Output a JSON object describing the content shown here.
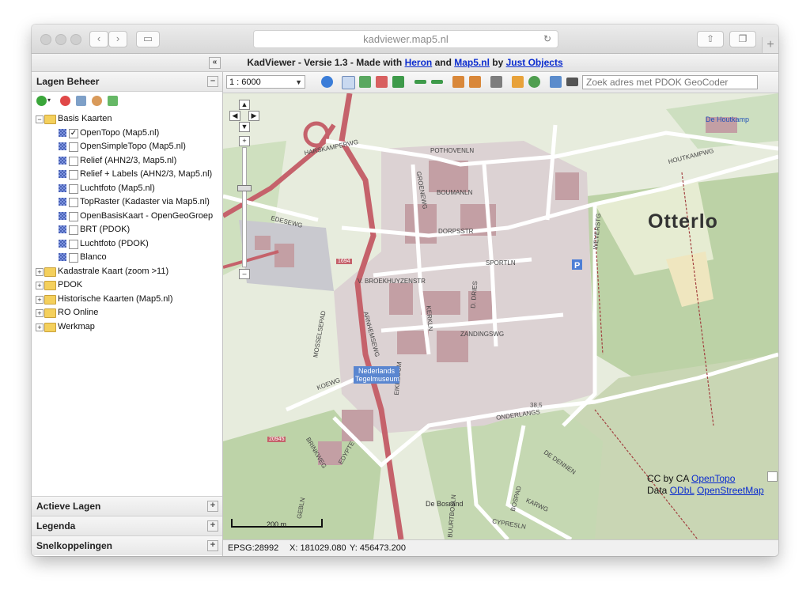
{
  "browser": {
    "url": "kadviewer.map5.nl"
  },
  "header": {
    "prefix": "KadViewer - Versie 1.3 - Made with ",
    "link1": "Heron",
    "and": " and ",
    "link2": "Map5.nl",
    "by": " by ",
    "link3": "Just Objects"
  },
  "sidebar": {
    "title": "Lagen Beheer",
    "tree": [
      {
        "label": "Basis Kaarten",
        "type": "folder",
        "expanded": true
      },
      {
        "label": "OpenTopo (Map5.nl)",
        "type": "layer",
        "checked": true
      },
      {
        "label": "OpenSimpleTopo (Map5.nl)",
        "type": "layer",
        "checked": false
      },
      {
        "label": "Relief (AHN2/3, Map5.nl)",
        "type": "layer",
        "checked": false
      },
      {
        "label": "Relief + Labels (AHN2/3, Map5.nl)",
        "type": "layer",
        "checked": false
      },
      {
        "label": "Luchtfoto (Map5.nl)",
        "type": "layer",
        "checked": false
      },
      {
        "label": "TopRaster (Kadaster via Map5.nl)",
        "type": "layer",
        "checked": false
      },
      {
        "label": "OpenBasisKaart - OpenGeoGroep",
        "type": "layer",
        "checked": false
      },
      {
        "label": "BRT (PDOK)",
        "type": "layer",
        "checked": false
      },
      {
        "label": "Luchtfoto (PDOK)",
        "type": "layer",
        "checked": false
      },
      {
        "label": "Blanco",
        "type": "layer",
        "checked": false
      },
      {
        "label": "Kadastrale Kaart (zoom >11)",
        "type": "folder",
        "expanded": false
      },
      {
        "label": "PDOK",
        "type": "folder",
        "expanded": false
      },
      {
        "label": "Historische Kaarten (Map5.nl)",
        "type": "folder",
        "expanded": false
      },
      {
        "label": "RO Online",
        "type": "folder",
        "expanded": false
      },
      {
        "label": "Werkmap",
        "type": "folder",
        "expanded": false
      }
    ],
    "bottom_panels": [
      "Actieve Lagen",
      "Legenda",
      "Snelkoppelingen"
    ]
  },
  "toolbar": {
    "scale_value": "1 : 6000",
    "search_placeholder": "Zoek adres met PDOK GeoCoder"
  },
  "map": {
    "place_label": "Otterlo",
    "streets": [
      "HARSKAMPERWG",
      "POTHOVENLN",
      "HOUTKAMPWG",
      "GROENEWG",
      "BOUMANLN",
      "DORPSSTR",
      "EDESEWG",
      "WEVERSTG",
      "SPORTLN",
      "V. BROEKHUYZENSTR",
      "MOSSELSEPAD",
      "ARNHEMSEWG",
      "KERKLN",
      "D. DRIES",
      "ZANDINGSWG",
      "KOEWG",
      "EIKEZOOM",
      "ONDERLANGS",
      "BRINKWEG",
      "EDYPTE",
      "DE DENNEN",
      "KARWG",
      "BOSPAD",
      "CYPRESLN",
      "BUURTBOSLN",
      "GEBLN"
    ],
    "pois": [
      "De Houtkamp",
      "Nederlands Tegelmuseum",
      "De Bosrand"
    ],
    "road_numbers": [
      "1694",
      "20945"
    ],
    "height_marker": "38,5",
    "scalebar_label": "200 m",
    "attribution_line1_prefix": "CC by CA ",
    "attribution_link1": "OpenTopo",
    "attribution_line2_prefix": "Data ",
    "attribution_link2": "ODbL",
    "attribution_link3": "OpenStreetMap"
  },
  "status": {
    "epsg": "EPSG:28992",
    "x_label": "X: 181029.080",
    "y_label": "Y: 456473.200"
  },
  "colors": {
    "main_road": "#c5626b",
    "minor_road": "#ffffff",
    "forest": "#bcd4a7",
    "built": "#d9cdd0",
    "link": "#0b2ccf"
  }
}
